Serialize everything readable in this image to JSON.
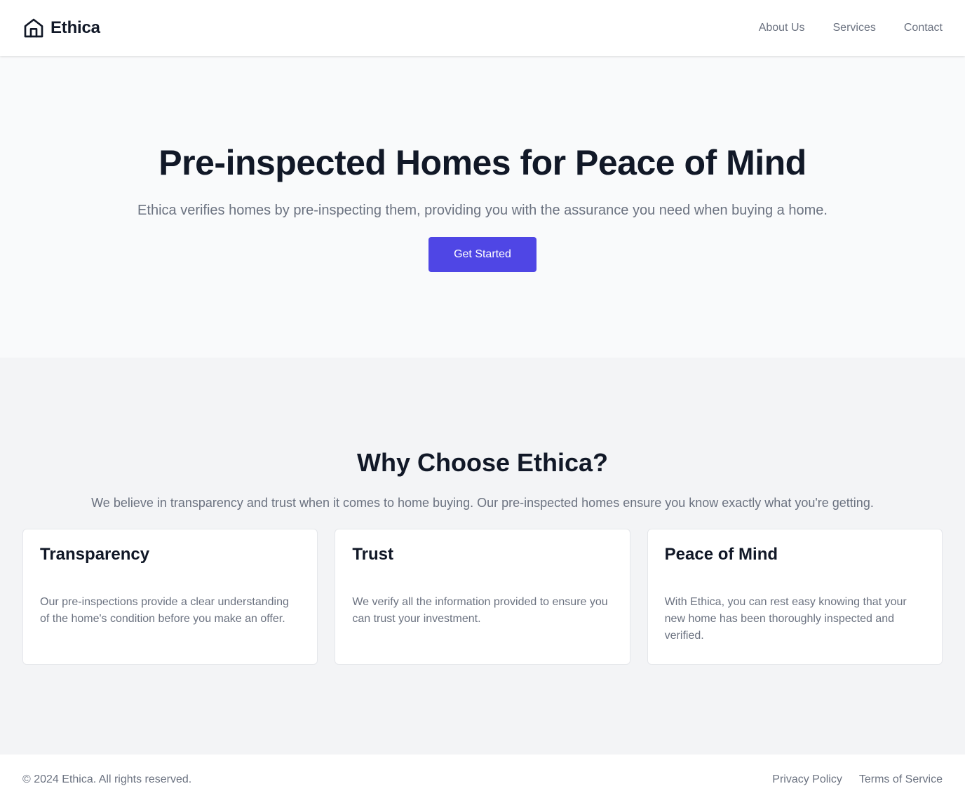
{
  "header": {
    "brand_icon": "house-icon",
    "brand_name": "Ethica",
    "nav": [
      "About Us",
      "Services",
      "Contact"
    ]
  },
  "hero": {
    "title": "Pre-inspected Homes for Peace of Mind",
    "subtitle": "Ethica verifies homes by pre-inspecting them, providing you with the assurance you need when buying a home.",
    "cta_label": "Get Started"
  },
  "why": {
    "title": "Why Choose Ethica?",
    "subtitle": "We believe in transparency and trust when it comes to home buying. Our pre-inspected homes ensure you know exactly what you're getting.",
    "cards": [
      {
        "title": "Transparency",
        "text": "Our pre-inspections provide a clear understanding of the home's condition before you make an offer."
      },
      {
        "title": "Trust",
        "text": "We verify all the information provided to ensure you can trust your investment."
      },
      {
        "title": "Peace of Mind",
        "text": "With Ethica, you can rest easy knowing that your new home has been thoroughly inspected and verified."
      }
    ]
  },
  "footer": {
    "copyright": "© 2024 Ethica. All rights reserved.",
    "links": [
      "Privacy Policy",
      "Terms of Service"
    ]
  },
  "colors": {
    "accent": "#4f46e5",
    "heading": "#111827",
    "muted_text": "#6b7280",
    "hero_bg": "#f9fafb",
    "section_bg": "#f3f4f6"
  }
}
